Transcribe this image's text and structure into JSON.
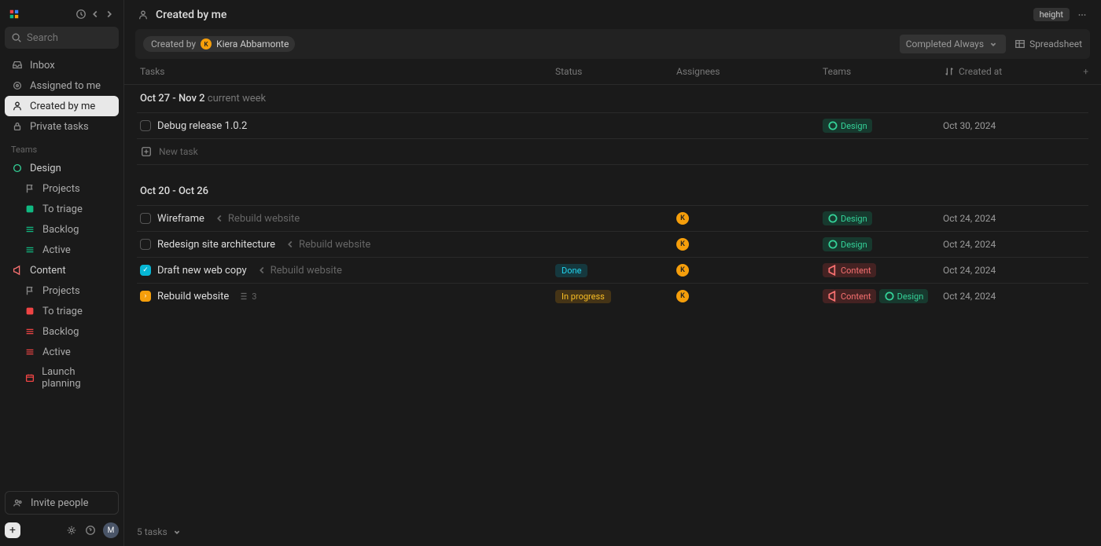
{
  "brand": "height",
  "search": {
    "placeholder": "Search"
  },
  "nav": {
    "inbox": "Inbox",
    "assigned": "Assigned to me",
    "created": "Created by me",
    "private": "Private tasks"
  },
  "teams_label": "Teams",
  "teams": [
    {
      "name": "Design",
      "color": "#34d399",
      "items": [
        "Projects",
        "To triage",
        "Backlog",
        "Active"
      ]
    },
    {
      "name": "Content",
      "color": "#f87171",
      "items": [
        "Projects",
        "To triage",
        "Backlog",
        "Active",
        "Launch planning"
      ]
    }
  ],
  "invite": "Invite people",
  "user_initial": "M",
  "page_title": "Created by me",
  "filter": {
    "label": "Created by",
    "user": "Kiera Abbamonte",
    "initial": "K"
  },
  "toolbar": {
    "completed": "Completed Always",
    "view": "Spreadsheet"
  },
  "columns": {
    "tasks": "Tasks",
    "status": "Status",
    "assignees": "Assignees",
    "teams": "Teams",
    "created": "Created at"
  },
  "groups": [
    {
      "title": "Oct 27 - Nov 2",
      "subtitle": "current week",
      "rows": [
        {
          "check": "open",
          "name": "Debug release 1.0.2",
          "parent": "",
          "status": "",
          "assignee": "",
          "teams": [
            "Design"
          ],
          "date": "Oct 30, 2024"
        }
      ],
      "new_task": "New task"
    },
    {
      "title": "Oct 20 - Oct 26",
      "subtitle": "",
      "rows": [
        {
          "check": "open",
          "name": "Wireframe",
          "parent": "Rebuild website",
          "status": "",
          "assignee": "K",
          "teams": [
            "Design"
          ],
          "date": "Oct 24, 2024"
        },
        {
          "check": "open",
          "name": "Redesign site architecture",
          "parent": "Rebuild website",
          "status": "",
          "assignee": "K",
          "teams": [
            "Design"
          ],
          "date": "Oct 24, 2024"
        },
        {
          "check": "done",
          "name": "Draft new web copy",
          "parent": "Rebuild website",
          "status": "Done",
          "assignee": "K",
          "teams": [
            "Content"
          ],
          "date": "Oct 24, 2024"
        },
        {
          "check": "prog",
          "name": "Rebuild website",
          "parent": "",
          "subtasks": "3",
          "status": "In progress",
          "assignee": "K",
          "teams": [
            "Content",
            "Design"
          ],
          "date": "Oct 24, 2024"
        }
      ]
    }
  ],
  "footer": "5 tasks"
}
